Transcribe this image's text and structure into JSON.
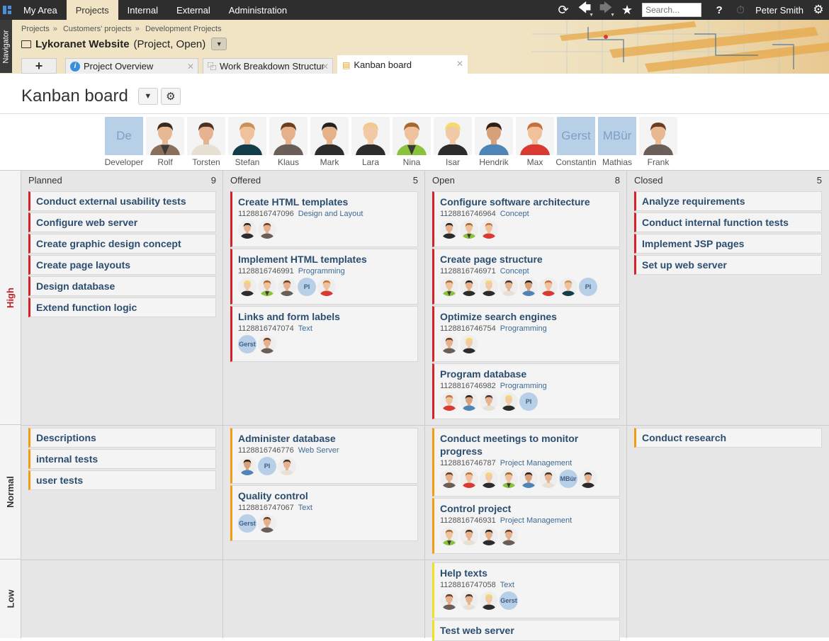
{
  "topnav": {
    "items": [
      "My Area",
      "Projects",
      "Internal",
      "External",
      "Administration"
    ],
    "active": "Projects"
  },
  "search": {
    "placeholder": "Search..."
  },
  "user": {
    "name": "Peter Smith"
  },
  "navigator": "Navigator",
  "breadcrumb": [
    "Projects",
    "Customers' projects",
    "Development Projects"
  ],
  "project": {
    "name": "Lykoranet Website",
    "status": "(Project, Open)"
  },
  "tabs": [
    "Project Overview",
    "Work Breakdown Structur",
    "Kanban board"
  ],
  "page": {
    "title": "Kanban board"
  },
  "people": [
    {
      "name": "Developer",
      "initials": "De"
    },
    {
      "name": "Rolf",
      "hair": "#3a2a1e",
      "skin": "#e8b893",
      "shirt": "#3b3b3b",
      "suit": "#8a6f5a"
    },
    {
      "name": "Torsten",
      "hair": "#4a3325",
      "skin": "#e6b38e",
      "shirt": "#e8e0d2",
      "suit": "#e8e0d2"
    },
    {
      "name": "Stefan",
      "hair": "#c8925a",
      "skin": "#efc29c",
      "shirt": "#143d4a",
      "suit": "#143d4a"
    },
    {
      "name": "Klaus",
      "hair": "#6b3e22",
      "skin": "#e6b08a",
      "shirt": "#6a5f58",
      "suit": "#6a5f58"
    },
    {
      "name": "Mark",
      "hair": "#222",
      "skin": "#e6b08a",
      "shirt": "#2c2c2c",
      "suit": "#2c2c2c"
    },
    {
      "name": "Lara",
      "hair": "#f0c890",
      "skin": "#f2c9a5",
      "shirt": "#2c2c2c",
      "suit": "#2c2c2c"
    },
    {
      "name": "Nina",
      "hair": "#a5682e",
      "skin": "#efc29c",
      "shirt": "#3a3a3a",
      "suit": "#8ac23b"
    },
    {
      "name": "Isar",
      "hair": "#f4dc6a",
      "skin": "#f2c9a5",
      "shirt": "#2c2c2c",
      "suit": "#2c2c2c"
    },
    {
      "name": "Hendrik",
      "hair": "#2d1f15",
      "skin": "#d8a07a",
      "shirt": "#4e84b6",
      "suit": "#4e84b6"
    },
    {
      "name": "Max",
      "hair": "#c8703a",
      "skin": "#efc29c",
      "shirt": "#d93a32",
      "suit": "#d93a32"
    },
    {
      "name": "Constantin",
      "initials": "Gerst"
    },
    {
      "name": "Mathias",
      "initials": "MBür"
    },
    {
      "name": "Frank",
      "hair": "#6b3e22",
      "skin": "#e8b893",
      "shirt": "#6a5f58",
      "suit": "#6a5f58"
    }
  ],
  "lanes": [
    "High",
    "Normal",
    "Low"
  ],
  "columns": [
    {
      "name": "Planned",
      "count": "9"
    },
    {
      "name": "Offered",
      "count": "5"
    },
    {
      "name": "Open",
      "count": "8"
    },
    {
      "name": "Closed",
      "count": "5"
    }
  ],
  "cards": {
    "high": {
      "planned": [
        "Conduct external usability tests",
        "Configure web server",
        "Create graphic design concept",
        "Create page layouts",
        "Design database",
        "Extend function logic"
      ],
      "offered": [
        {
          "title": "Create HTML templates",
          "id": "1128816747096",
          "cat": "Design and Layout",
          "avs": [
            "Mark",
            "Klaus"
          ]
        },
        {
          "title": "Implement HTML templates",
          "id": "1128816746991",
          "cat": "Programming",
          "avs": [
            "Isar",
            "Nina",
            "Klaus",
            "PI",
            "Max"
          ]
        },
        {
          "title": "Links and form labels",
          "id": "1128816747074",
          "cat": "Text",
          "avs": [
            "Gerst",
            "Klaus"
          ]
        }
      ],
      "open": [
        {
          "title": "Configure software architecture",
          "id": "1128816746964",
          "cat": "Concept",
          "avs": [
            "Mark",
            "Nina",
            "Max"
          ]
        },
        {
          "title": "Create page structure",
          "id": "1128816746971",
          "cat": "Concept",
          "avs": [
            "Nina",
            "Mark",
            "Isar",
            "Torsten",
            "Hendrik",
            "Max",
            "Stefan",
            "PI"
          ]
        },
        {
          "title": "Optimize search engines",
          "id": "1128816746754",
          "cat": "Programming",
          "avs": [
            "Klaus",
            "Isar"
          ]
        },
        {
          "title": "Program database",
          "id": "1128816746982",
          "cat": "Programming",
          "avs": [
            "Max",
            "Hendrik",
            "Torsten",
            "Isar",
            "PI"
          ]
        }
      ],
      "closed": [
        "Analyze requirements",
        "Conduct internal function tests",
        "Implement JSP pages",
        "Set up web server"
      ]
    },
    "normal": {
      "planned": [
        "Descriptions",
        "internal tests",
        "user tests"
      ],
      "offered": [
        {
          "title": "Administer database",
          "id": "1128816746776",
          "cat": "Web Server",
          "avs": [
            "Hendrik",
            "PI",
            "Torsten"
          ]
        },
        {
          "title": "Quality control",
          "id": "1128816747067",
          "cat": "Text",
          "avs": [
            "Gerst",
            "Klaus"
          ]
        }
      ],
      "open": [
        {
          "title": "Conduct meetings to monitor progress",
          "id": "1128816746787",
          "cat": "Project Management",
          "avs": [
            "Klaus",
            "Max",
            "Isar",
            "Nina",
            "Hendrik",
            "Torsten",
            "MBür",
            "Mark"
          ]
        },
        {
          "title": "Control project",
          "id": "1128816746931",
          "cat": "Project Management",
          "avs": [
            "Nina",
            "Torsten",
            "Mark",
            "Klaus"
          ]
        }
      ],
      "closed": [
        "Conduct research"
      ]
    },
    "low": {
      "open": [
        {
          "title": "Help texts",
          "id": "1128816747058",
          "cat": "Text",
          "avs": [
            "Klaus",
            "Torsten",
            "Isar",
            "Gerst"
          ]
        },
        {
          "title": "Test web server"
        }
      ]
    }
  },
  "colors": {
    "high": "#d4212a",
    "normal": "#f39c12",
    "low": "#f0e020",
    "accent": "#2b4d6f"
  }
}
